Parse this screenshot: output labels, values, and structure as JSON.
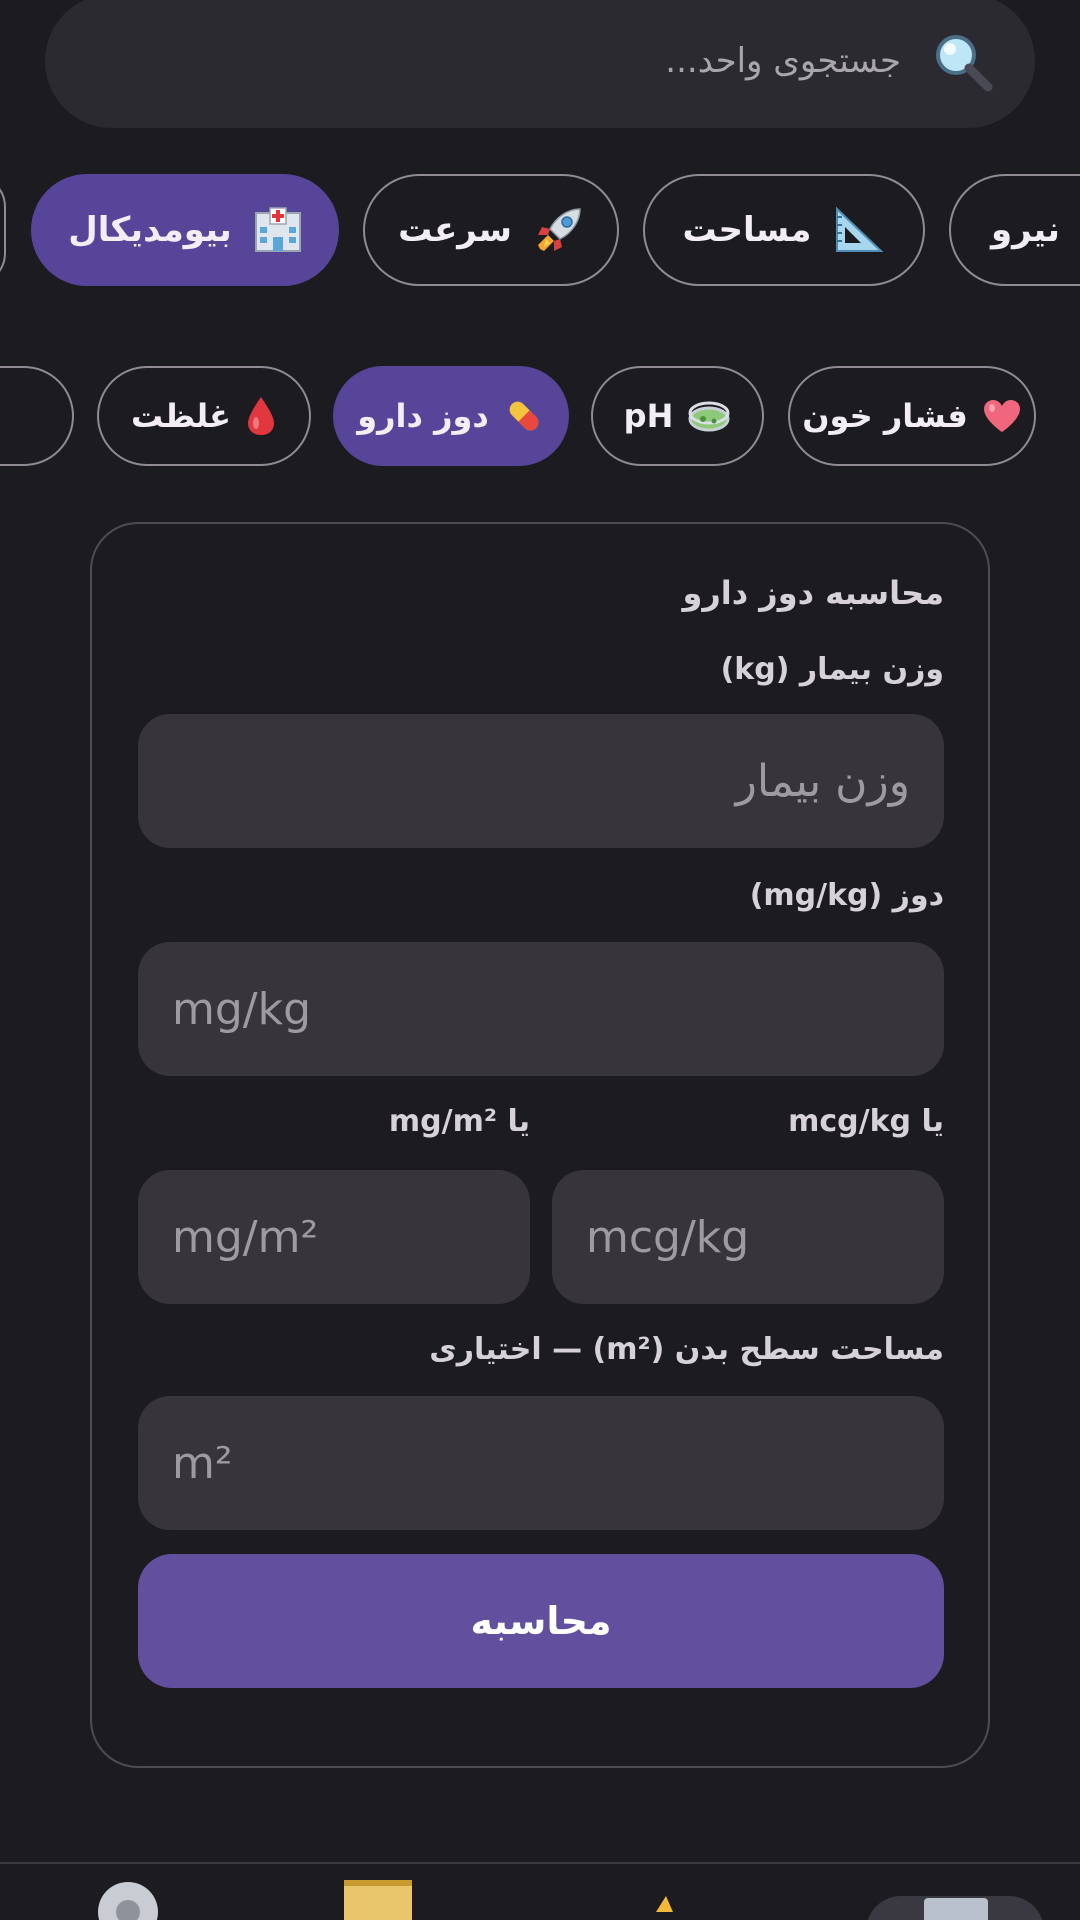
{
  "search": {
    "placeholder": "جستجوی واحد...",
    "icon": "magnifier-icon"
  },
  "categories": [
    {
      "label": "بیومدیکال",
      "icon": "hospital-icon",
      "active": true
    },
    {
      "label": "سرعت",
      "icon": "rocket-icon",
      "active": false
    },
    {
      "label": "مساحت",
      "icon": "triangle-ruler-icon",
      "active": false
    },
    {
      "label": "نیرو",
      "icon": "flexed-arm-icon",
      "active": false
    }
  ],
  "subcategories": [
    {
      "label": "غلظت",
      "icon": "drop-of-blood-icon",
      "active": false
    },
    {
      "label": "دوز دارو",
      "icon": "pill-icon",
      "active": true
    },
    {
      "label": "pH",
      "icon": "petri-dish-icon",
      "active": false
    },
    {
      "label": "فشار خون",
      "icon": "heart-icon",
      "active": false
    }
  ],
  "form": {
    "title": "محاسبه دوز دارو",
    "weight_label": "وزن بیمار (kg)",
    "weight_placeholder": "وزن بیمار",
    "dose_label": "دوز (mg/kg)",
    "dose_placeholder": "mg/kg",
    "mcg_label": "یا mcg/kg",
    "mcg_placeholder": "mcg/kg",
    "mgm2_label": "یا mg/m²",
    "mgm2_placeholder": "mg/m²",
    "bsa_label": "مساحت سطح بدن (m²) — اختیاری",
    "bsa_placeholder": "m²",
    "calculate_label": "محاسبه"
  },
  "colors": {
    "background": "#1c1b20",
    "surface": "#2b2a30",
    "field": "#37353b",
    "accent": "#574599",
    "button": "#62509e",
    "border": "#8f8a96"
  },
  "bottom_nav": [
    {
      "icon": "settings-icon"
    },
    {
      "icon": "notes-icon"
    },
    {
      "icon": "star-icon"
    },
    {
      "icon": "calculator-icon",
      "active": true
    }
  ]
}
